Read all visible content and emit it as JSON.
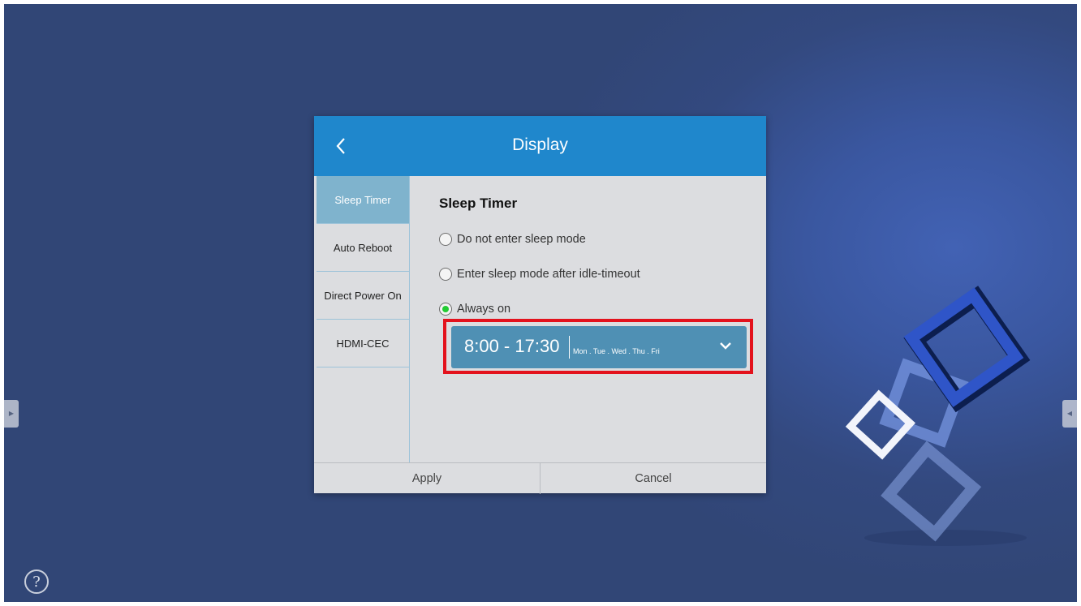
{
  "dialog": {
    "title": "Display",
    "back_icon": "chevron-left-icon"
  },
  "sidebar": {
    "items": [
      {
        "label": "Sleep Timer",
        "active": true
      },
      {
        "label": "Auto Reboot",
        "active": false
      },
      {
        "label": "Direct Power On",
        "active": false
      },
      {
        "label": "HDMI-CEC",
        "active": false
      }
    ]
  },
  "content": {
    "section_title": "Sleep Timer",
    "options": [
      {
        "label": "Do not enter sleep mode",
        "selected": false
      },
      {
        "label": "Enter sleep mode after idle-timeout",
        "selected": false
      },
      {
        "label": "Always on",
        "selected": true
      }
    ],
    "schedule": {
      "time_range": "8:00 - 17:30",
      "days": "Mon . Tue . Wed . Thu . Fri",
      "dropdown_icon": "chevron-down-icon"
    }
  },
  "footer": {
    "apply_label": "Apply",
    "cancel_label": "Cancel"
  },
  "screen": {
    "help_label": "?",
    "help_icon": "question-circle-icon",
    "colors": {
      "header": "#1f87cc",
      "active_tab": "#7fb3cd",
      "schedule_bg": "#4f90b4",
      "highlight": "#e3121d",
      "radio_checked": "#22cc33"
    }
  }
}
